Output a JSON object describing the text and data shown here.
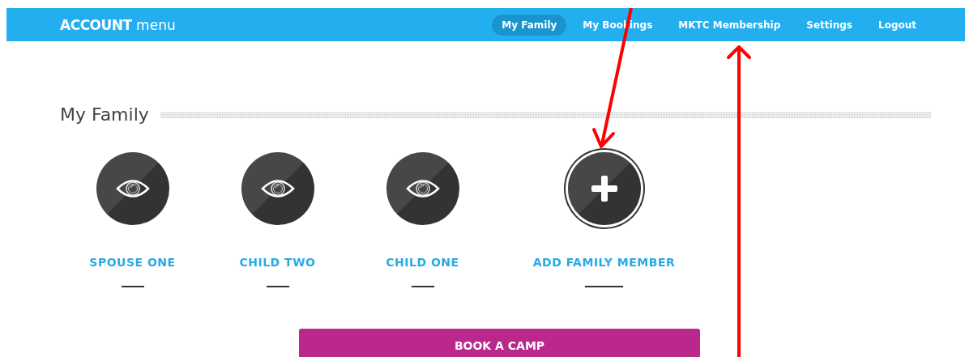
{
  "header": {
    "brand_bold": "ACCOUNT",
    "brand_light": "menu"
  },
  "nav": [
    {
      "label": "My Family",
      "selected": true
    },
    {
      "label": "My Bookings",
      "selected": false
    },
    {
      "label": "MKTC Membership",
      "selected": false
    },
    {
      "label": "Settings",
      "selected": false
    },
    {
      "label": "Logout",
      "selected": false
    }
  ],
  "section": {
    "title": "My Family"
  },
  "members": [
    {
      "kind": "person",
      "name": "SPOUSE ONE"
    },
    {
      "kind": "person",
      "name": "CHILD TWO"
    },
    {
      "kind": "person",
      "name": "CHILD ONE"
    },
    {
      "kind": "add",
      "name": "ADD FAMILY MEMBER"
    }
  ],
  "book_button": {
    "label": "BOOK A CAMP"
  }
}
